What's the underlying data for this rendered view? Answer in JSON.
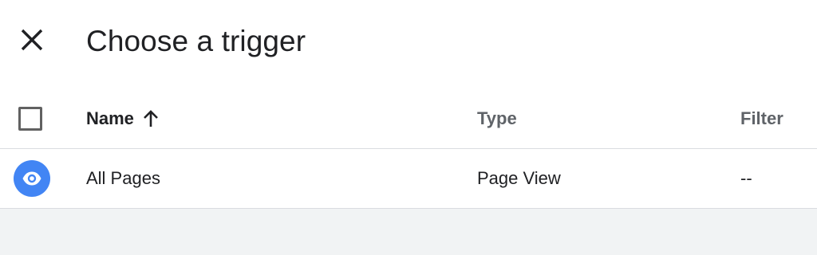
{
  "header": {
    "title": "Choose a trigger",
    "close_icon": "close-icon"
  },
  "table": {
    "columns": [
      {
        "label": "Name",
        "sort_icon": "arrow-up-icon",
        "sorted": "ascending"
      },
      {
        "label": "Type"
      },
      {
        "label": "Filter"
      }
    ],
    "rows": [
      {
        "icon": "eye-icon",
        "icon_color": "#4285f4",
        "name": "All Pages",
        "type": "Page View",
        "filter": "--"
      }
    ]
  },
  "colors": {
    "accent": "#4285f4",
    "text": "#202124",
    "secondary_text": "#5f6368",
    "background": "#f1f3f4"
  }
}
